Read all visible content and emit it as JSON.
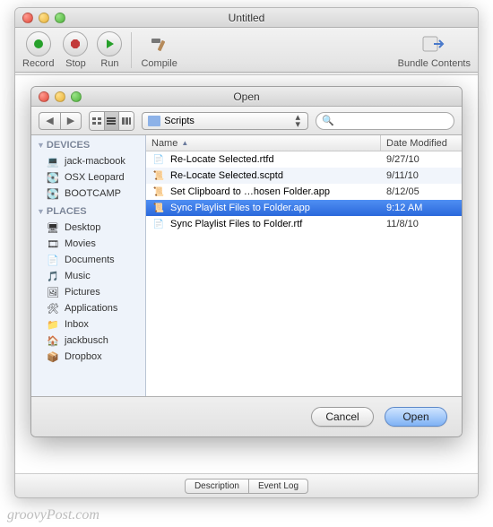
{
  "main": {
    "title": "Untitled",
    "toolbar": {
      "record": "Record",
      "stop": "Stop",
      "run": "Run",
      "compile": "Compile",
      "bundle": "Bundle Contents"
    },
    "tabs": {
      "description": "Description",
      "eventlog": "Event Log"
    }
  },
  "open": {
    "title": "Open",
    "path": "Scripts",
    "search_placeholder": "",
    "columns": {
      "name": "Name",
      "date": "Date Modified"
    },
    "buttons": {
      "cancel": "Cancel",
      "open": "Open"
    },
    "sidebar": {
      "devices_label": "DEVICES",
      "places_label": "PLACES",
      "devices": [
        {
          "label": "jack-macbook",
          "icon": "💻"
        },
        {
          "label": "OSX Leopard",
          "icon": "💽"
        },
        {
          "label": "BOOTCAMP",
          "icon": "💽"
        }
      ],
      "places": [
        {
          "label": "Desktop",
          "icon": "🖥"
        },
        {
          "label": "Movies",
          "icon": "🎞"
        },
        {
          "label": "Documents",
          "icon": "📄"
        },
        {
          "label": "Music",
          "icon": "🎵"
        },
        {
          "label": "Pictures",
          "icon": "🖼"
        },
        {
          "label": "Applications",
          "icon": "🛠"
        },
        {
          "label": "Inbox",
          "icon": "📁"
        },
        {
          "label": "jackbusch",
          "icon": "🏠"
        },
        {
          "label": "Dropbox",
          "icon": "📦"
        }
      ]
    },
    "rows": [
      {
        "name": "Re-Locate Selected.rtfd",
        "date": "9/27/10",
        "icon": "📄",
        "selected": false
      },
      {
        "name": "Re-Locate Selected.scptd",
        "date": "9/11/10",
        "icon": "📜",
        "selected": false
      },
      {
        "name": "Set Clipboard to …hosen Folder.app",
        "date": "8/12/05",
        "icon": "📜",
        "selected": false
      },
      {
        "name": "Sync Playlist Files to Folder.app",
        "date": "9:12 AM",
        "icon": "📜",
        "selected": true
      },
      {
        "name": "Sync Playlist Files to Folder.rtf",
        "date": "11/8/10",
        "icon": "📄",
        "selected": false
      }
    ]
  },
  "watermark": "groovyPost.com"
}
